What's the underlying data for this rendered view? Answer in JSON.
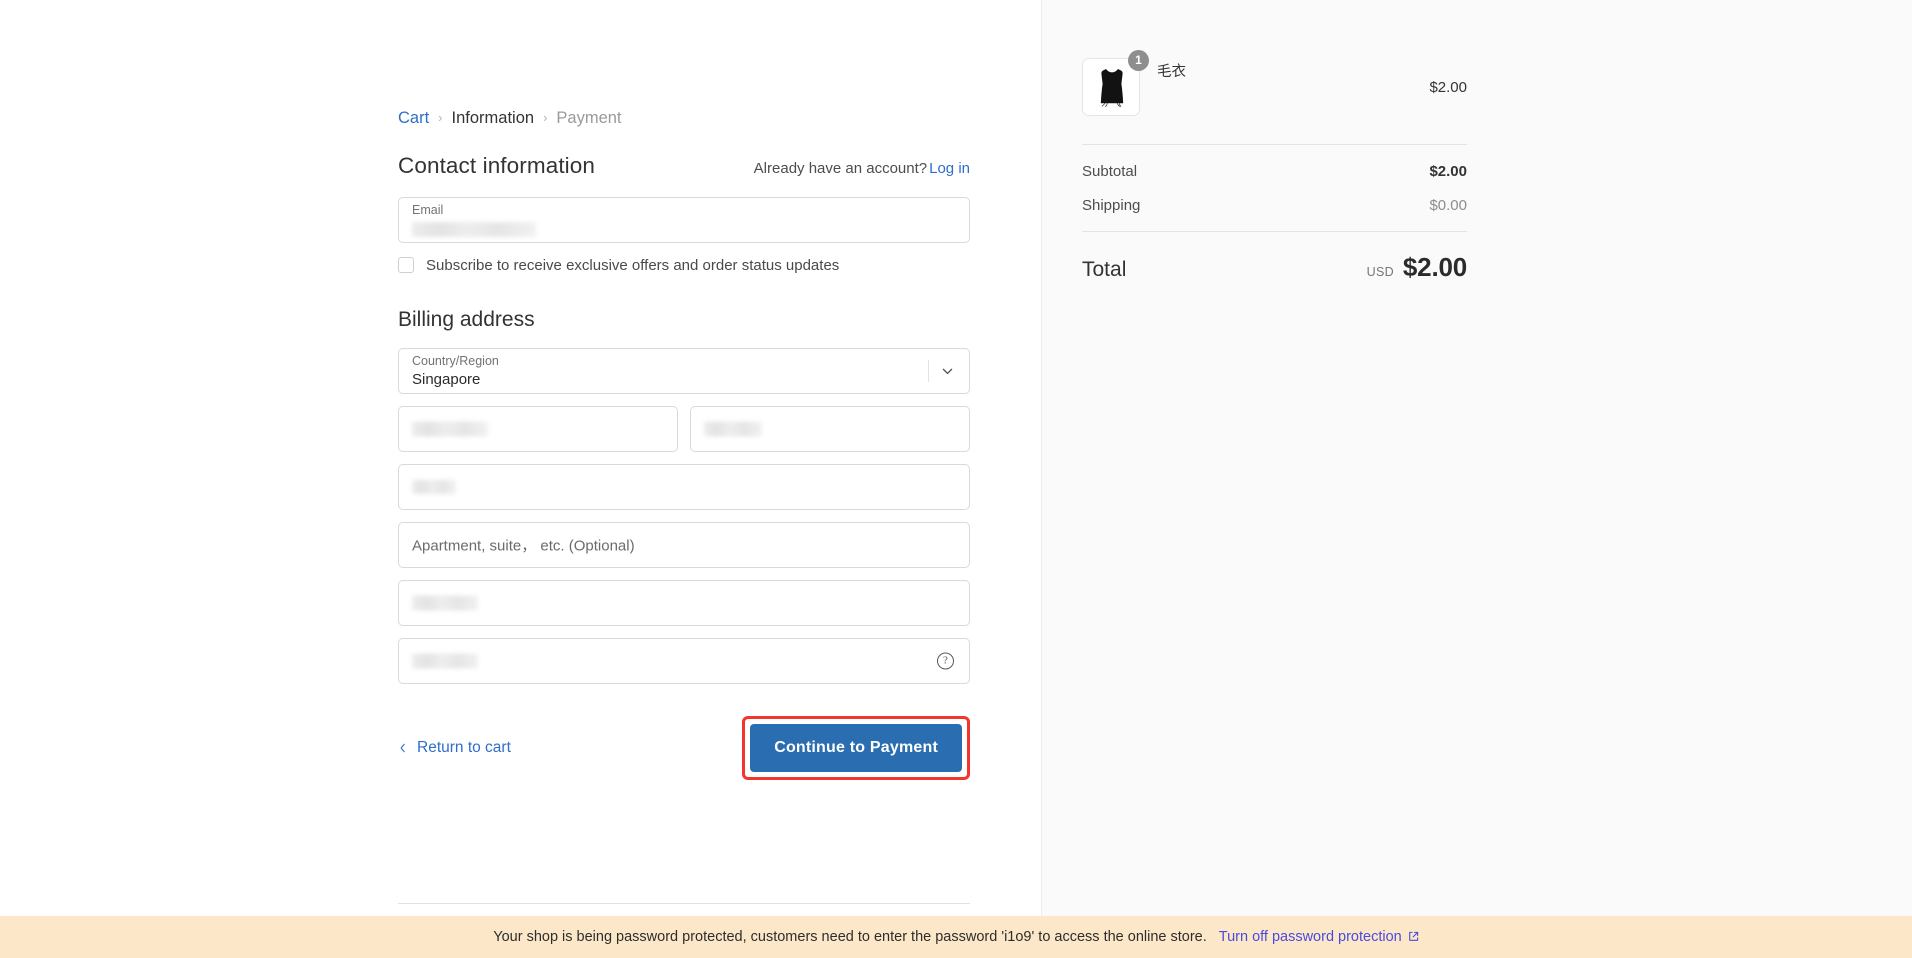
{
  "breadcrumb": {
    "cart": "Cart",
    "information": "Information",
    "payment": "Payment",
    "separator": "›"
  },
  "contact": {
    "title": "Contact information",
    "account_prompt": "Already have an account?",
    "login_label": "Log in",
    "email_label": "Email",
    "email_value": "",
    "subscribe_label": "Subscribe to receive exclusive offers and order status updates",
    "subscribe_checked": false
  },
  "billing": {
    "title": "Billing address",
    "country_label": "Country/Region",
    "country_value": "Singapore",
    "first_name_value": "",
    "last_name_value": "",
    "address_value": "",
    "apartment_placeholder": "Apartment, suite， etc. (Optional)",
    "city_value": "",
    "postal_value": "",
    "help_icon_label": "?"
  },
  "actions": {
    "return_label": "Return to cart",
    "continue_label": "Continue to Payment",
    "highlight_color": "#f4352d",
    "button_color": "#2a6db0"
  },
  "summary": {
    "item": {
      "name": "毛衣",
      "quantity": "1",
      "price": "$2.00"
    },
    "subtotal_label": "Subtotal",
    "subtotal_value": "$2.00",
    "shipping_label": "Shipping",
    "shipping_value": "$0.00",
    "total_label": "Total",
    "total_currency": "USD",
    "total_value": "$2.00"
  },
  "footer": {
    "text": ""
  },
  "password_banner": {
    "message": "Your shop is being password protected, customers need to enter the password 'i1o9' to access the online store.",
    "link_label": "Turn off password protection",
    "background": "#fce8c8",
    "link_color": "#4a4ae0"
  }
}
